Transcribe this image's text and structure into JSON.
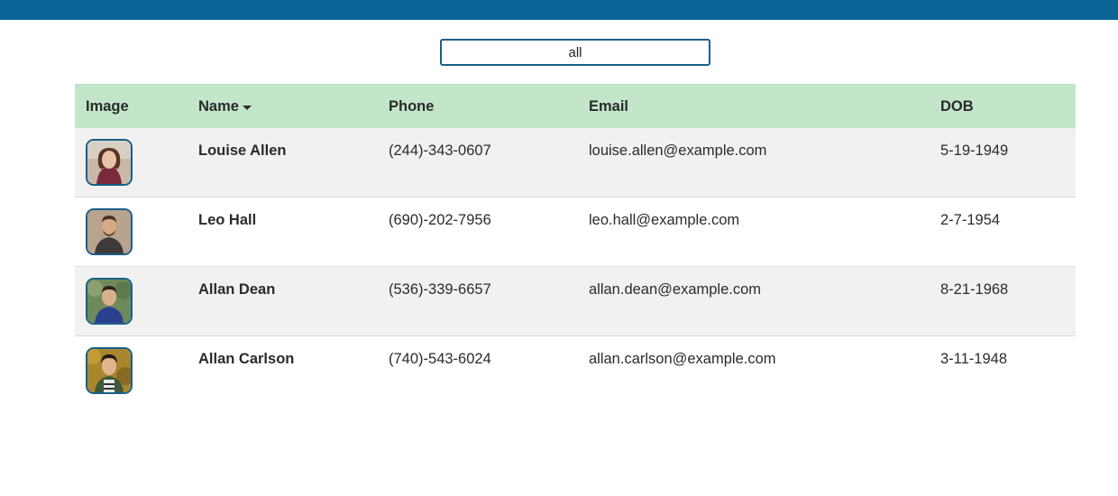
{
  "search": {
    "value": "all"
  },
  "table": {
    "headers": {
      "image": "Image",
      "name": "Name",
      "phone": "Phone",
      "email": "Email",
      "dob": "DOB"
    },
    "sort": {
      "column": "Name",
      "direction": "descending-caret"
    },
    "rows": [
      {
        "name": "Louise Allen",
        "phone": "(244)-343-0607",
        "email": "louise.allen@example.com",
        "dob": "5-19-1949"
      },
      {
        "name": "Leo Hall",
        "phone": "(690)-202-7956",
        "email": "leo.hall@example.com",
        "dob": "2-7-1954"
      },
      {
        "name": "Allan Dean",
        "phone": "(536)-339-6657",
        "email": "allan.dean@example.com",
        "dob": "8-21-1968"
      },
      {
        "name": "Allan Carlson",
        "phone": "(740)-543-6024",
        "email": "allan.carlson@example.com",
        "dob": "3-11-1948"
      }
    ]
  },
  "colors": {
    "topbar": "#0a6496",
    "header_bg": "#c3e6cb",
    "row_shaded": "#f1f1f1",
    "avatar_border": "#1a5f8a"
  }
}
